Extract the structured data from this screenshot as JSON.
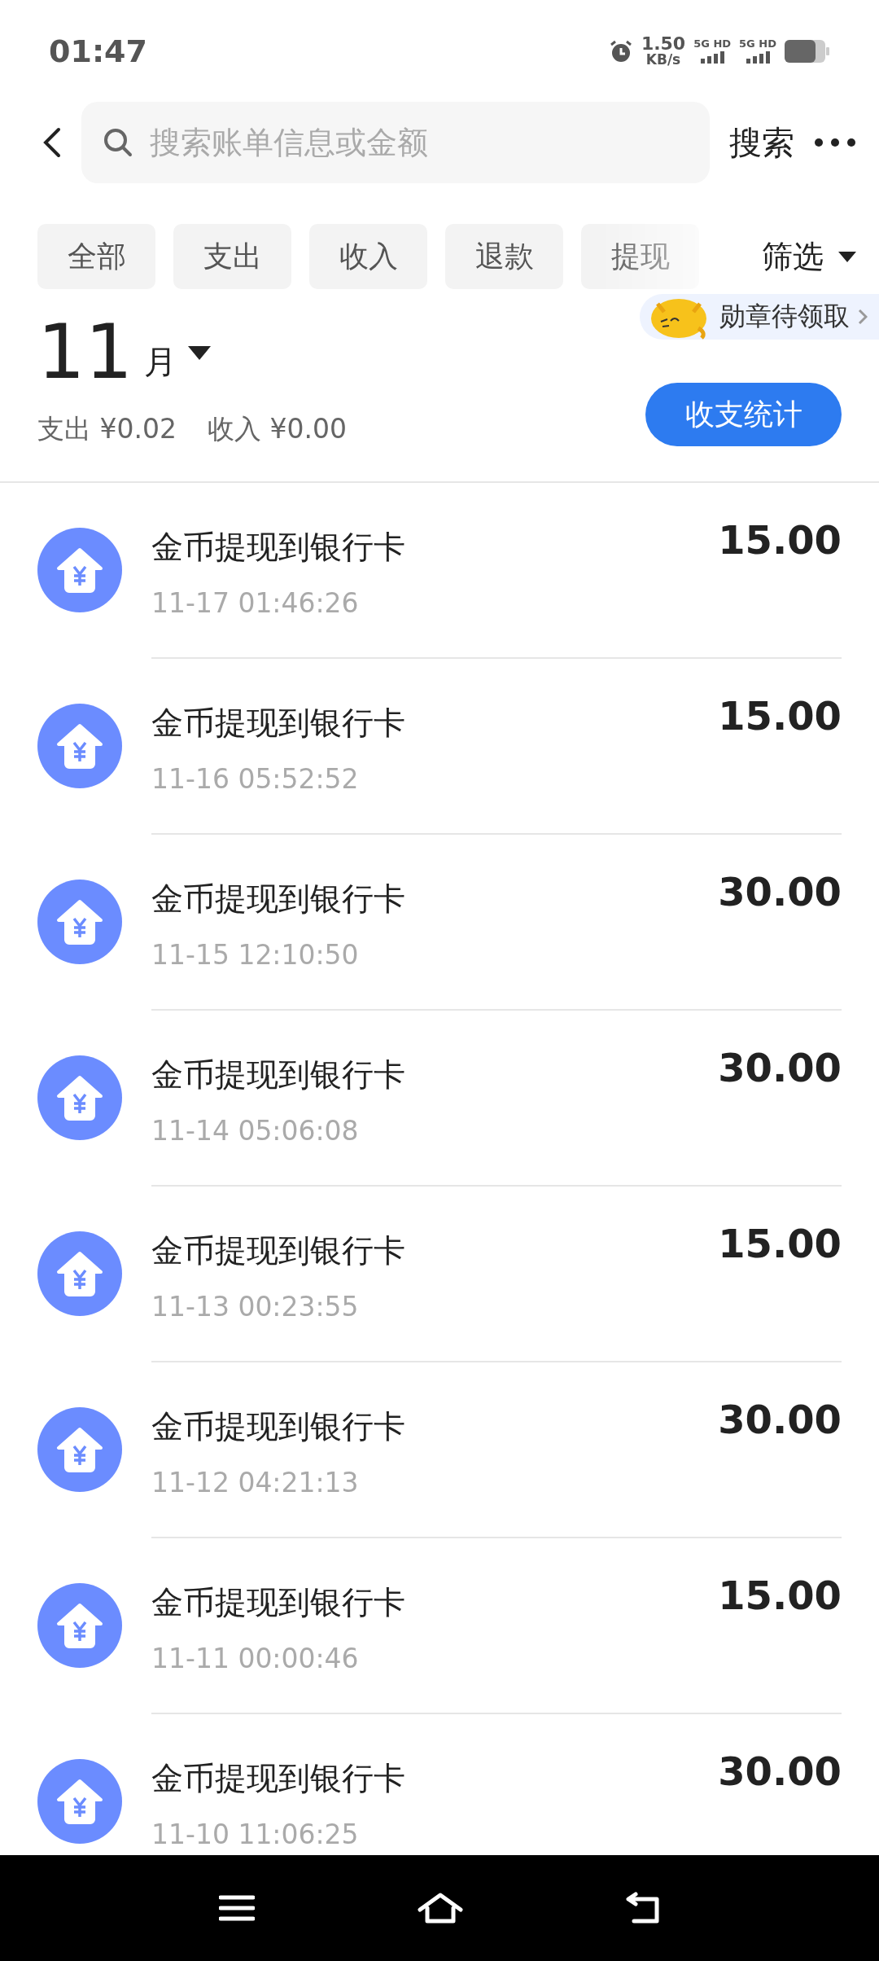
{
  "status_bar": {
    "time": "01:47",
    "speed": "1.50",
    "speed_unit": "KB/s",
    "networks": [
      "5G HD",
      "5G HD"
    ]
  },
  "search": {
    "placeholder": "搜索账单信息或金额",
    "button": "搜索"
  },
  "filters": [
    {
      "label": "全部",
      "selected": false
    },
    {
      "label": "支出",
      "selected": false
    },
    {
      "label": "收入",
      "selected": false
    },
    {
      "label": "退款",
      "selected": false
    },
    {
      "label": "提现",
      "selected": false
    }
  ],
  "filter_menu": "筛选",
  "banner": "勋章待领取",
  "month": {
    "number": "11",
    "unit": "月"
  },
  "summary": {
    "expense": "支出 ¥0.02",
    "income": "收入 ¥0.00"
  },
  "stats_button": "收支统计",
  "transactions": [
    {
      "title": "金币提现到银行卡",
      "time": "11-17 01:46:26",
      "amount": "15.00"
    },
    {
      "title": "金币提现到银行卡",
      "time": "11-16 05:52:52",
      "amount": "15.00"
    },
    {
      "title": "金币提现到银行卡",
      "time": "11-15 12:10:50",
      "amount": "30.00"
    },
    {
      "title": "金币提现到银行卡",
      "time": "11-14 05:06:08",
      "amount": "30.00"
    },
    {
      "title": "金币提现到银行卡",
      "time": "11-13 00:23:55",
      "amount": "15.00"
    },
    {
      "title": "金币提现到银行卡",
      "time": "11-12 04:21:13",
      "amount": "30.00"
    },
    {
      "title": "金币提现到银行卡",
      "time": "11-11 00:00:46",
      "amount": "15.00"
    },
    {
      "title": "金币提现到银行卡",
      "time": "11-10 11:06:25",
      "amount": "30.00"
    }
  ]
}
